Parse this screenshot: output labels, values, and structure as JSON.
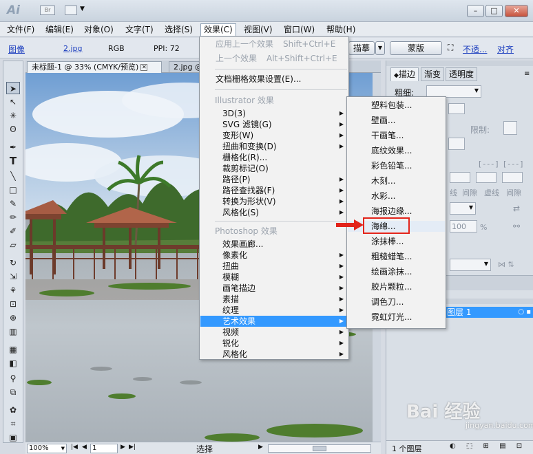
{
  "app": {
    "logo": "Ai",
    "bridge_label": "Br"
  },
  "menubar": [
    "文件(F)",
    "编辑(E)",
    "对象(O)",
    "文字(T)",
    "选择(S)",
    "效果(C)",
    "视图(V)",
    "窗口(W)",
    "帮助(H)"
  ],
  "controlbar": {
    "image_label": "图像",
    "file_name": "2.jpg",
    "color_mode": "RGB",
    "ppi": "PPI: 72",
    "trace_button": "描摹",
    "mask_button": "蒙版",
    "opacity_link": "不透...",
    "align_link": "对齐"
  },
  "doc_tabs": [
    {
      "label": "未标题-1 @ 33% (CMYK/预览)",
      "active": true
    },
    {
      "label": "2.jpg @",
      "active": false
    }
  ],
  "effect_menu": {
    "items_top": [
      {
        "label": "应用上一个效果",
        "shortcut": "Shift+Ctrl+E",
        "disabled": true
      },
      {
        "label": "上一个效果",
        "shortcut": "Alt+Shift+Ctrl+E",
        "disabled": true
      }
    ],
    "raster_settings": "文档栅格效果设置(E)...",
    "illustrator_header": "Illustrator 效果",
    "illustrator_items": [
      {
        "label": "3D(3)",
        "submenu": true
      },
      {
        "label": "SVG 滤镜(G)",
        "submenu": true
      },
      {
        "label": "变形(W)",
        "submenu": true
      },
      {
        "label": "扭曲和变换(D)",
        "submenu": true
      },
      {
        "label": "栅格化(R)...",
        "submenu": false
      },
      {
        "label": "裁剪标记(O)",
        "submenu": false
      },
      {
        "label": "路径(P)",
        "submenu": true
      },
      {
        "label": "路径查找器(F)",
        "submenu": true
      },
      {
        "label": "转换为形状(V)",
        "submenu": true
      },
      {
        "label": "风格化(S)",
        "submenu": true
      }
    ],
    "photoshop_header": "Photoshop 效果",
    "photoshop_items": [
      {
        "label": "效果画廊...",
        "submenu": false
      },
      {
        "label": "像素化",
        "submenu": true
      },
      {
        "label": "扭曲",
        "submenu": true
      },
      {
        "label": "模糊",
        "submenu": true
      },
      {
        "label": "画笔描边",
        "submenu": true
      },
      {
        "label": "素描",
        "submenu": true
      },
      {
        "label": "纹理",
        "submenu": true
      },
      {
        "label": "艺术效果",
        "submenu": true,
        "highlighted": true
      },
      {
        "label": "视频",
        "submenu": true
      },
      {
        "label": "锐化",
        "submenu": true
      },
      {
        "label": "风格化",
        "submenu": true
      }
    ]
  },
  "artistic_submenu": [
    "塑料包装...",
    "壁画...",
    "干画笔...",
    "底纹效果...",
    "彩色铅笔...",
    "木刻...",
    "水彩...",
    "海报边缘...",
    "海绵...",
    "涂抹棒...",
    "粗糙蜡笔...",
    "绘画涂抹...",
    "胶片颗粒...",
    "调色刀...",
    "霓虹灯光..."
  ],
  "right_panel": {
    "tabs": [
      "描边",
      "渐变",
      "透明度"
    ],
    "weight_label": "粗细:",
    "limit_label": "限制:",
    "dash_labels": [
      "线",
      "间隙",
      "虚线",
      "间隙"
    ],
    "opacity_value": "100",
    "percent": "%",
    "layer_name": "图层 1",
    "layer_count": "1 个图层"
  },
  "statusbar": {
    "zoom": "100%",
    "page": "1",
    "mode": "选择"
  },
  "watermark": {
    "main": "Bai 经验",
    "sub": "jingyan.baidu.com"
  },
  "colors": {
    "menu_highlight": "#3399ff",
    "callout_red": "#e2231a"
  }
}
